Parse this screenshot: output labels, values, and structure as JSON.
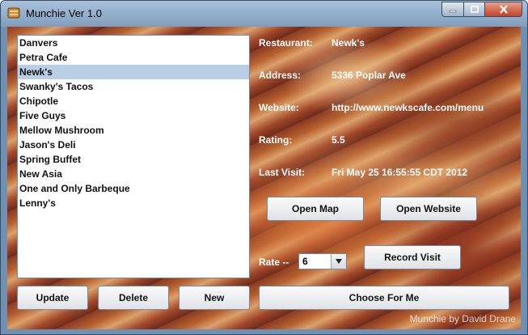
{
  "window": {
    "title": "Munchie  Ver 1.0",
    "icon": "munchie-app-icon"
  },
  "restaurants": [
    "Danvers",
    "Petra Cafe",
    "Newk's",
    "Swanky's Tacos",
    "Chipotle",
    "Five Guys",
    "Mellow Mushroom",
    "Jason's Deli",
    "Spring Buffet",
    "New Asia",
    "One and Only Barbeque",
    "Lenny's"
  ],
  "selected_restaurant": "Newk's",
  "details": {
    "restaurant_label": "Restaurant:",
    "restaurant_value": "Newk's",
    "address_label": "Address:",
    "address_value": "5336 Poplar Ave",
    "website_label": "Website:",
    "website_value": "http://www.newkscafe.com/menu",
    "rating_label": "Rating:",
    "rating_value": "5.5",
    "last_visit_label": "Last Visit:",
    "last_visit_value": "Fri May 25 16:55:55 CDT 2012"
  },
  "buttons": {
    "open_map": "Open Map",
    "open_website": "Open Website",
    "record_visit": "Record Visit",
    "update": "Update",
    "delete": "Delete",
    "new": "New",
    "choose_for_me": "Choose For Me"
  },
  "rate": {
    "label": "Rate --",
    "value": "6"
  },
  "credit": "Munchie by David Drane"
}
